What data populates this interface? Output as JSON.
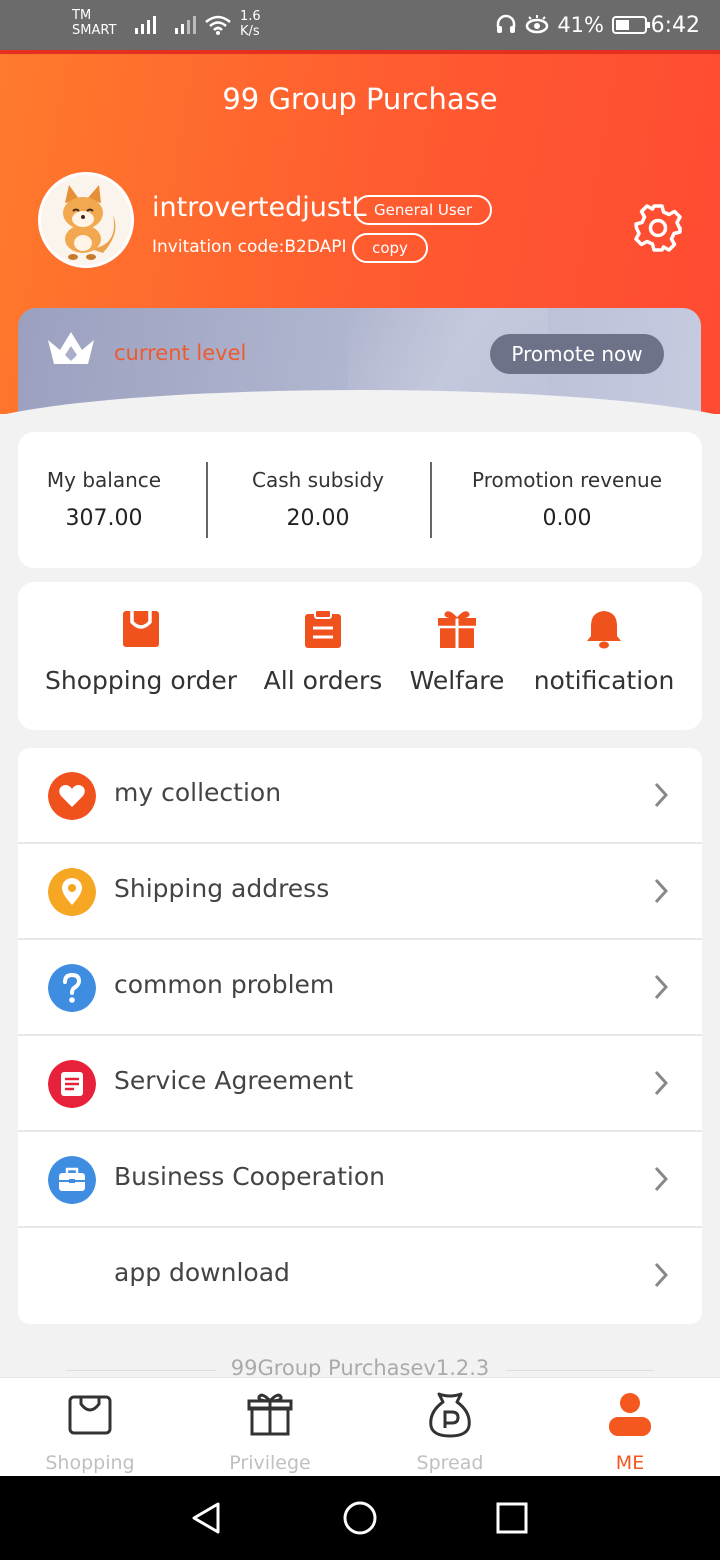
{
  "status_bar": {
    "carrier_line1": "TM",
    "carrier_line2": "SMART",
    "speed_value": "1.6",
    "speed_unit": "K/s",
    "battery": "41%",
    "time": "6:42"
  },
  "header": {
    "title": "99 Group Purchase",
    "username": "introvertedjustL",
    "user_badge": "General User",
    "invitation": "Invitation code:B2DAPI",
    "copy_label": "copy",
    "settings_icon": "gear-icon"
  },
  "level": {
    "label": "current level",
    "promote_label": "Promote now",
    "icon": "crown-icon"
  },
  "stats": [
    {
      "label": "My balance",
      "value": "307.00"
    },
    {
      "label": "Cash subsidy",
      "value": "20.00"
    },
    {
      "label": "Promotion revenue",
      "value": "0.00"
    }
  ],
  "quick_actions": [
    {
      "label": "Shopping order",
      "icon": "shopping-bag-icon"
    },
    {
      "label": "All orders",
      "icon": "clipboard-icon"
    },
    {
      "label": "Welfare",
      "icon": "gift-icon"
    },
    {
      "label": "notification",
      "icon": "bell-icon"
    }
  ],
  "menu": [
    {
      "label": "my collection",
      "icon": "heart-icon",
      "color": "#f0521e"
    },
    {
      "label": "Shipping address",
      "icon": "location-pin-icon",
      "color": "#f5a623"
    },
    {
      "label": "common problem",
      "icon": "question-icon",
      "color": "#3f8de0"
    },
    {
      "label": "Service Agreement",
      "icon": "document-icon",
      "color": "#e8213a"
    },
    {
      "label": "Business Cooperation",
      "icon": "briefcase-icon",
      "color": "#3f8de0"
    },
    {
      "label": "app download",
      "icon": "",
      "color": ""
    }
  ],
  "version": "99Group Purchasev1.2.3",
  "tabs": [
    {
      "label": "Shopping",
      "icon": "shopping-bag-icon",
      "active": false
    },
    {
      "label": "Privilege",
      "icon": "gift-icon",
      "active": false
    },
    {
      "label": "Spread",
      "icon": "parking-bag-icon",
      "active": false
    },
    {
      "label": "ME",
      "icon": "person-icon",
      "active": true
    }
  ],
  "colors": {
    "brand": "#ff5a30",
    "active_tab": "#f5581f",
    "level_card": "#a9aecb"
  }
}
